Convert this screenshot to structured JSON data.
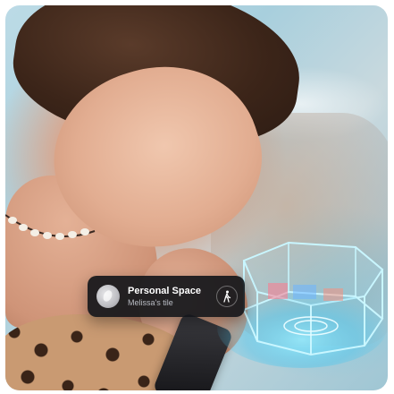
{
  "tile_card": {
    "title": "Personal Space",
    "subtitle": "Melissa's tile",
    "action_icon": "walking-person-icon"
  }
}
